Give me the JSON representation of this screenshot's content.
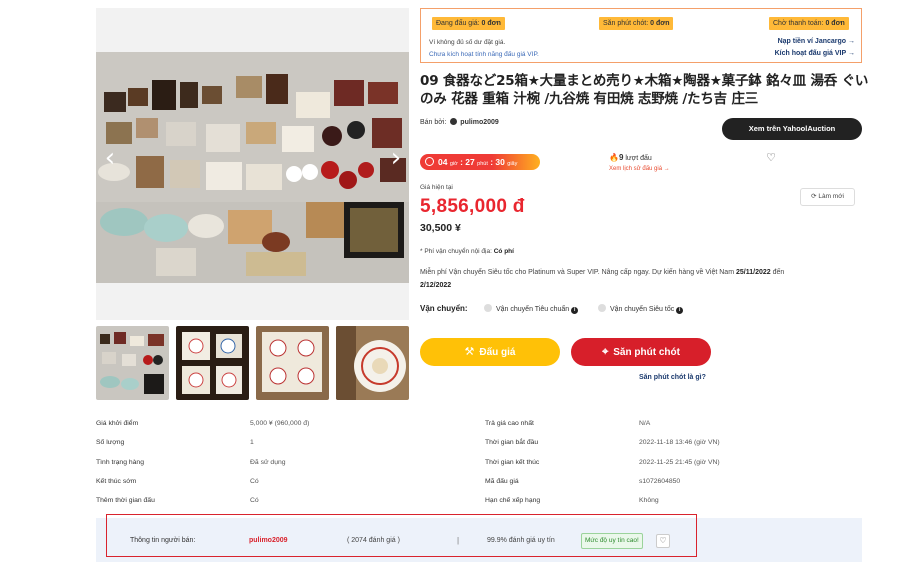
{
  "status": {
    "pills": [
      {
        "label": "Đang đấu giá:",
        "value": "0 đơn"
      },
      {
        "label": "Săn phút chót:",
        "value": "0 đơn"
      },
      {
        "label": "Chờ thanh toán:",
        "value": "0 đơn"
      }
    ],
    "balance_note": "Ví không đủ số dư đặt giá.",
    "vip_note": "Chưa kích hoạt tính năng đấu giá VIP.",
    "topup_link": "Nạp tiền ví Jancargo →",
    "vip_link": "Kích hoạt đấu giá VIP →"
  },
  "product": {
    "title": "09 食器など25箱★大量まとめ売り★木箱★陶器★菓子鉢 銘々皿 湯呑 ぐいのみ 花器 重箱 汁椀 /九谷焼 有田焼 志野焼 /たち吉 庄三",
    "seller_prefix": "Bán bởi:",
    "seller_name": "pulimo2009",
    "yahoo_button": "Xem trên YahoolAuction",
    "timer": {
      "h": "04",
      "h_unit": "giờ",
      "m": "27",
      "m_unit": "phút",
      "s": "30",
      "s_unit": "giây"
    },
    "bid_count": "9",
    "bid_count_label": "lượt đấu",
    "bid_history_link": "Xem lịch sử đấu giá →",
    "current_price_label": "Giá hiện tại",
    "price_vnd": "5,856,000 đ",
    "price_jpy": "30,500 ¥",
    "refresh_label": "Làm mới",
    "domestic_ship_label": "* Phí vận chuyển nội địa:",
    "domestic_ship_value": "Có phí",
    "free_ship_text": "Miễn phí Vận chuyển Siêu tốc cho Platinum và Super VIP. Nâng cấp ngay. Dự kiến hàng về Việt Nam",
    "free_ship_date_range": "25/11/2022",
    "free_ship_mid": "đến",
    "free_ship_date_end": "2/12/2022",
    "shipping_label": "Vận chuyển:",
    "shipping_options": [
      "Vận chuyển Tiêu chuẩn",
      "Vận chuyển Siêu tốc"
    ],
    "bid_button": "Đấu giá",
    "snipe_button": "Săn phút chót",
    "snipe_help": "Săn phút chót là gì?"
  },
  "details": {
    "left": [
      {
        "k": "Giá khởi điểm",
        "v": "5,000 ¥ (960,000 đ)"
      },
      {
        "k": "Số lượng",
        "v": "1"
      },
      {
        "k": "Tình trạng hàng",
        "v": "Đã sử dụng"
      },
      {
        "k": "Kết thúc sớm",
        "v": "Có"
      },
      {
        "k": "Thêm thời gian đấu",
        "v": "Có"
      }
    ],
    "right": [
      {
        "k": "Trả giá cao nhất",
        "v": "N/A"
      },
      {
        "k": "Thời gian bắt đầu",
        "v": "2022-11-18 13:46 (giờ VN)"
      },
      {
        "k": "Thời gian kết thúc",
        "v": "2022-11-25 21:45 (giờ VN)"
      },
      {
        "k": "Mã đấu giá",
        "v": "s1072604850"
      },
      {
        "k": "Hạn chế xếp hạng",
        "v": "Không"
      }
    ]
  },
  "seller_bar": {
    "label": "Thông tin người bán:",
    "name": "pulimo2009",
    "reviews": "( 2074 đánh giá )",
    "separator": "|",
    "rating": "99.9% đánh giá uy tín",
    "badge": "Mức độ uy tín cao!"
  },
  "colors": {
    "accent_red": "#e9262f",
    "accent_yellow": "#ffc107",
    "snipe_red": "#d71f2a",
    "status_orange": "#ffb938"
  }
}
